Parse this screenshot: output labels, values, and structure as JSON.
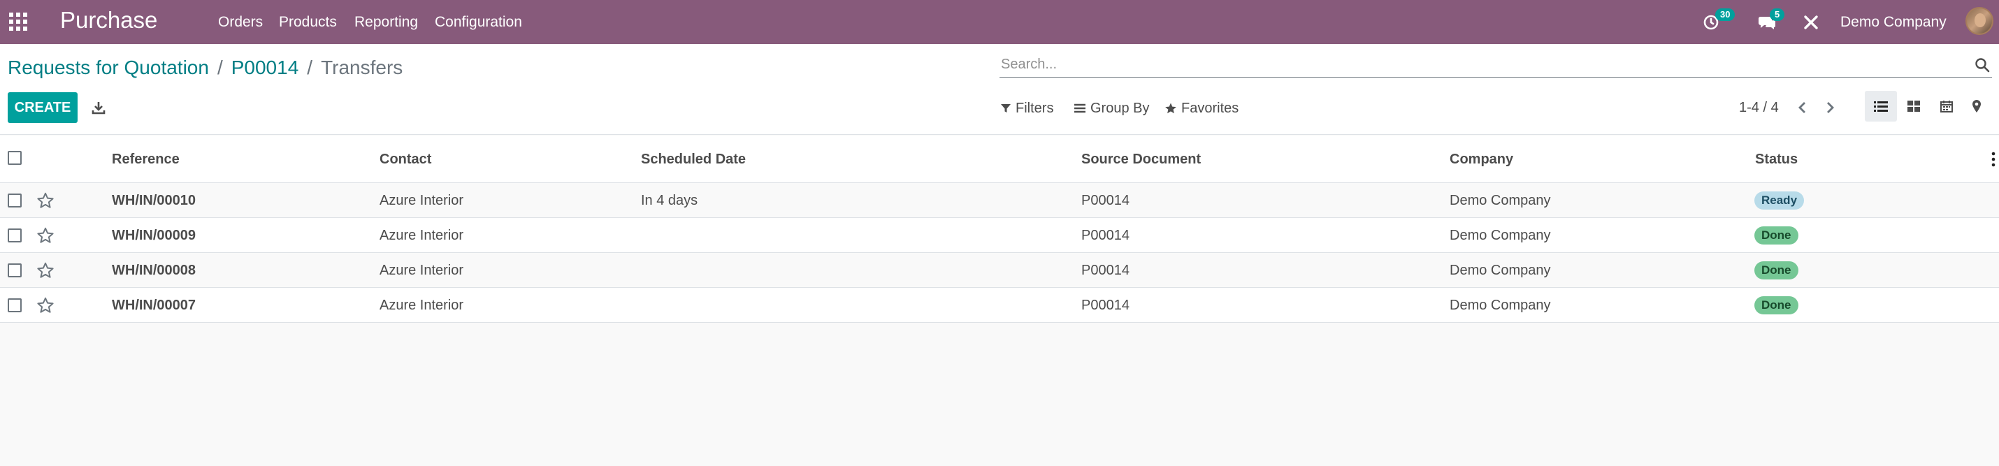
{
  "navbar": {
    "brand": "Purchase",
    "menu": [
      "Orders",
      "Products",
      "Reporting",
      "Configuration"
    ],
    "activity_count": "30",
    "messages_count": "5",
    "company": "Demo Company"
  },
  "breadcrumb": {
    "items": [
      "Requests for Quotation",
      "P00014"
    ],
    "current": "Transfers",
    "separator": "/"
  },
  "toolbar": {
    "create_label": "CREATE"
  },
  "search": {
    "placeholder": "Search..."
  },
  "filters": {
    "filters_label": "Filters",
    "group_by_label": "Group By",
    "favorites_label": "Favorites"
  },
  "pager": {
    "value": "1-4 / 4"
  },
  "views": [
    "list-icon",
    "kanban-icon",
    "calendar-icon",
    "map-marker-icon"
  ],
  "table": {
    "columns": [
      "Reference",
      "Contact",
      "Scheduled Date",
      "Source Document",
      "Company",
      "Status"
    ],
    "rows": [
      {
        "reference": "WH/IN/00010",
        "contact": "Azure Interior",
        "scheduled_date": "In 4 days",
        "source": "P00014",
        "company": "Demo Company",
        "status": "Ready"
      },
      {
        "reference": "WH/IN/00009",
        "contact": "Azure Interior",
        "scheduled_date": "",
        "source": "P00014",
        "company": "Demo Company",
        "status": "Done"
      },
      {
        "reference": "WH/IN/00008",
        "contact": "Azure Interior",
        "scheduled_date": "",
        "source": "P00014",
        "company": "Demo Company",
        "status": "Done"
      },
      {
        "reference": "WH/IN/00007",
        "contact": "Azure Interior",
        "scheduled_date": "",
        "source": "P00014",
        "company": "Demo Company",
        "status": "Done"
      }
    ]
  },
  "colors": {
    "navbar": "#875a7b",
    "primary": "#00a09d",
    "link": "#017e84",
    "status_ready": "#b8dbe9",
    "status_done": "#75c795"
  }
}
